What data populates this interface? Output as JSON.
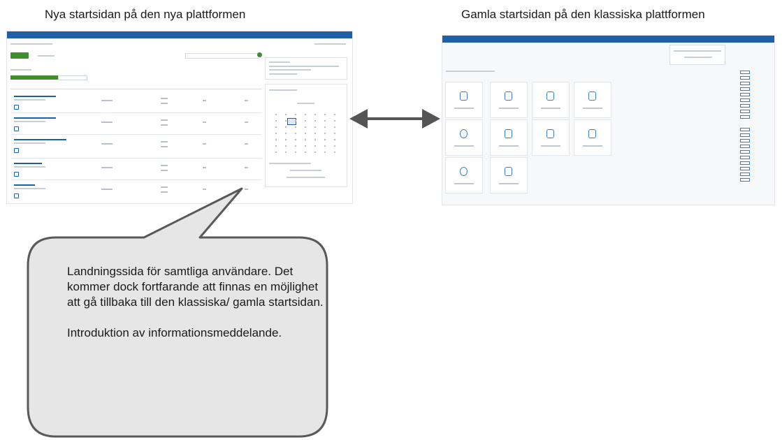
{
  "captions": {
    "new_platform": "Nya startsidan på den nya plattformen",
    "old_platform": "Gamla startsidan på den klassiska plattformen"
  },
  "callout": {
    "paragraph_1": "Landningssida för samtliga användare. Det kommer dock fortfarande att finnas en möjlighet att gå tillbaka till den klassiska/ gamla startsidan.",
    "paragraph_2": "Introduktion av informationsmeddelande."
  },
  "colors": {
    "nav_blue": "#1f5fa8",
    "accent_green": "#3f8d2c",
    "callout_fill": "#e6e6e6",
    "callout_border": "#595959",
    "arrow": "#555555"
  }
}
